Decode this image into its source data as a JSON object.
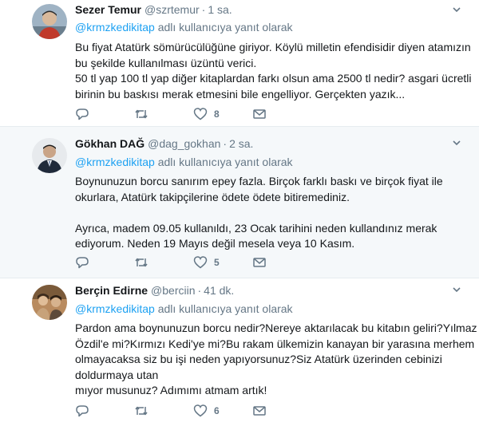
{
  "tweets": [
    {
      "name": "Sezer Temur",
      "handle": "@szrtemur",
      "time": "1 sa.",
      "reply_to": "@krmzkedikitap",
      "reply_suffix": "adlı kullanıcıya yanıt olarak",
      "lines": [
        "Bu fiyat Atatürk sömürücülüğüne giriyor. Köylü milletin efendisidir diyen atamızın",
        "bu şekilde kullanılması üzüntü verici.",
        "50 tl yap 100 tl yap diğer kitaplardan farkı olsun ama 2500 tl nedir? asgari ücretli",
        "birinin bu baskısı merak etmesini bile engelliyor. Gerçekten yazık..."
      ],
      "reply_count": "",
      "retweet_count": "",
      "like_count": "8"
    },
    {
      "name": "Gökhan DAĞ",
      "handle": "@dag_gokhan",
      "time": "2 sa.",
      "reply_to": "@krmzkedikitap",
      "reply_suffix": "adlı kullanıcıya yanıt olarak",
      "lines": [
        "Boynunuzun borcu sanırım epey fazla. Birçok farklı baskı ve birçok fiyat ile",
        "okurlara, Atatürk takipçilerine ödete ödete bitiremediniz.",
        "",
        "Ayrıca, madem 09.05 kullanıldı, 23 Ocak tarihini neden kullandınız merak",
        "ediyorum. Neden 19 Mayıs değil mesela veya 10 Kasım."
      ],
      "reply_count": "",
      "retweet_count": "",
      "like_count": "5"
    },
    {
      "name": "Berçin Edirne",
      "handle": "@berciin",
      "time": "41 dk.",
      "reply_to": "@krmzkedikitap",
      "reply_suffix": "adlı kullanıcıya yanıt olarak",
      "lines": [
        "Pardon ama boynunuzun borcu nedir?Nereye aktarılacak bu kitabın geliri?Yılmaz",
        "Özdil'e mi?Kırmızı Kedi'ye mi?Bu rakam ülkemizin kanayan bir yarasına merhem",
        "olmayacaksa siz bu işi neden yapıyorsunuz?Siz Atatürk üzerinden cebinizi",
        "doldurmaya utan",
        "mıyor musunuz? Adımımı atmam artık!"
      ],
      "reply_count": "",
      "retweet_count": "",
      "like_count": "6"
    }
  ],
  "colors": {
    "link": "#1da1f2",
    "muted": "#657786",
    "highlight_bg": "#f5f8fa"
  },
  "icons": [
    "chevron-down-icon",
    "reply-icon",
    "retweet-icon",
    "heart-icon",
    "direct-message-icon"
  ]
}
